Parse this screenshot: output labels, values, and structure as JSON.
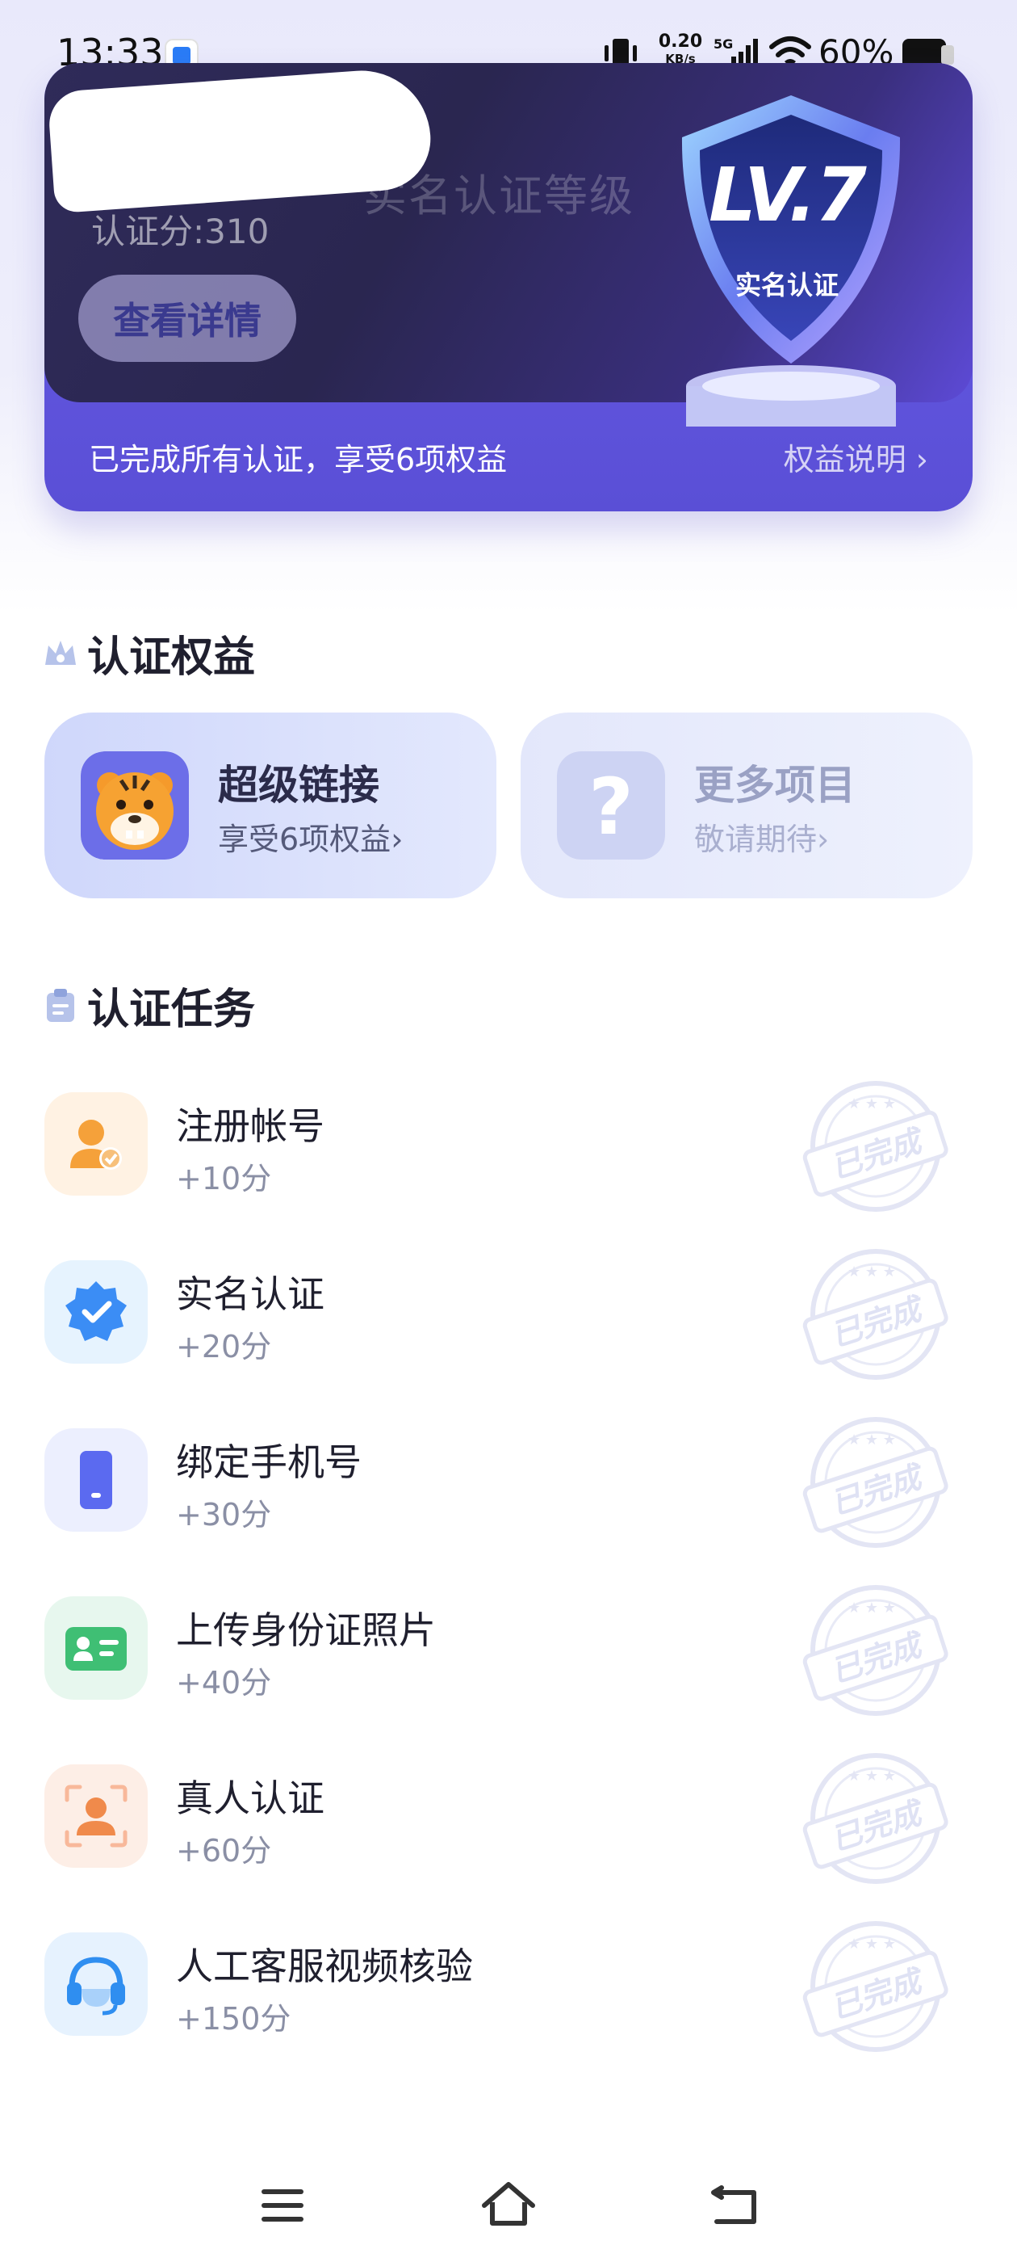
{
  "status_bar": {
    "time": "13:33",
    "net_speed": "0.20",
    "net_unit": "KB/s",
    "network": "5G",
    "battery": "60%"
  },
  "level_card": {
    "title": "实名认证等级",
    "score_label": "认证分:310",
    "details_button": "查看详情",
    "badge_level": "LV.7",
    "badge_caption": "实名认证",
    "summary": "已完成所有认证，享受6项权益",
    "benefits_link": "权益说明",
    "colors": {
      "card": "#5a4fd6",
      "dark": "#2a2650"
    }
  },
  "benefits_section": {
    "heading": "认证权益",
    "cards": [
      {
        "title": "超级链接",
        "subtitle": "享受6项权益",
        "icon": "tiger-icon"
      },
      {
        "title": "更多项目",
        "subtitle": "敬请期待",
        "icon": "question-icon"
      }
    ]
  },
  "tasks_section": {
    "heading": "认证任务",
    "stamp": "已完成",
    "items": [
      {
        "name": "注册帐号",
        "points": "+10分",
        "icon": "user-check-icon",
        "color": "#f5a13a"
      },
      {
        "name": "实名认证",
        "points": "+20分",
        "icon": "verified-badge-icon",
        "color": "#3b8df5"
      },
      {
        "name": "绑定手机号",
        "points": "+30分",
        "icon": "phone-icon",
        "color": "#5b6af0"
      },
      {
        "name": "上传身份证照片",
        "points": "+40分",
        "icon": "id-card-icon",
        "color": "#3fbf74"
      },
      {
        "name": "真人认证",
        "points": "+60分",
        "icon": "face-scan-icon",
        "color": "#f08a4b"
      },
      {
        "name": "人工客服视频核验",
        "points": "+150分",
        "icon": "headset-icon",
        "color": "#2f8ef0"
      }
    ]
  },
  "nav_bar": {
    "icons": [
      "menu-icon",
      "home-icon",
      "back-icon"
    ]
  }
}
